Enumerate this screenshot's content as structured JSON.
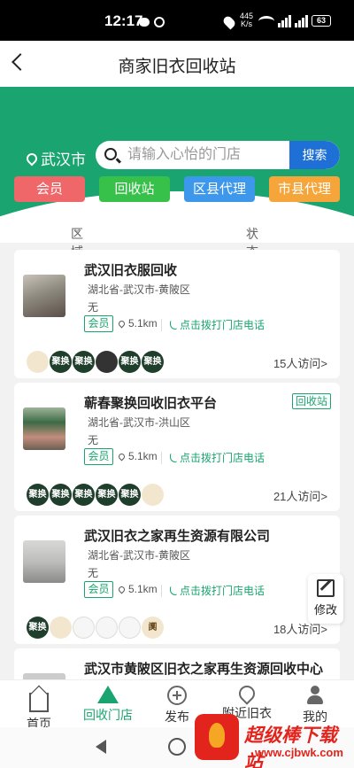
{
  "status_bar": {
    "time": "12:17",
    "net_speed_value": "445",
    "net_speed_unit": "K/s",
    "battery": "63"
  },
  "header": {
    "title": "商家旧衣回收站"
  },
  "banner": {
    "city": "武汉市",
    "search_placeholder": "请输入心怡的门店",
    "search_button": "搜索",
    "categories": [
      {
        "label": "会员",
        "color": "#f0676a"
      },
      {
        "label": "回收站",
        "color": "#38c14a"
      },
      {
        "label": "区县代理",
        "color": "#3d97ea"
      },
      {
        "label": "市县代理",
        "color": "#f5a53a"
      }
    ],
    "accent_color": "#1aa570"
  },
  "filters": {
    "region": "区域",
    "status": "状态"
  },
  "shops": [
    {
      "name": "武汉旧衣服回收",
      "address": "湖北省-武汉市-黄陂区",
      "desc": "无",
      "badge": "会员",
      "distance": "5.1km",
      "call": "点击拨打门店电话",
      "tag": "",
      "avatars": [
        "",
        "聚换",
        "聚换",
        "",
        "聚换",
        "聚换"
      ],
      "visits": "15人访问>"
    },
    {
      "name": "蕲春聚换回收旧衣平台",
      "address": "湖北省-武汉市-洪山区",
      "desc": "无",
      "badge": "会员",
      "distance": "5.1km",
      "call": "点击拨打门店电话",
      "tag": "回收站",
      "avatars": [
        "聚换",
        "聚换",
        "聚换",
        "聚换",
        "聚换",
        ""
      ],
      "visits": "21人访问>"
    },
    {
      "name": "武汉旧衣之家再生资源有限公司",
      "address": "湖北省-武汉市-黄陂区",
      "desc": "无",
      "badge": "会员",
      "distance": "5.1km",
      "call": "点击拨打门店电话",
      "tag": "",
      "avatars": [
        "聚换",
        "",
        "",
        "",
        "",
        "阒"
      ],
      "visits": "18人访问>"
    },
    {
      "name": "武汉市黄陂区旧衣之家再生资源回收中心"
    }
  ],
  "float_button": {
    "label": "修改"
  },
  "tabbar": [
    {
      "label": "首页",
      "icon": "home-icon"
    },
    {
      "label": "回收门店",
      "icon": "recycle-icon",
      "active": true
    },
    {
      "label": "发布",
      "icon": "plus-icon"
    },
    {
      "label": "附近旧衣",
      "icon": "nearby-icon"
    },
    {
      "label": "我的",
      "icon": "person-icon"
    }
  ],
  "watermark": {
    "title": "超级棒下载站",
    "url": "www.cjbwk.com"
  }
}
